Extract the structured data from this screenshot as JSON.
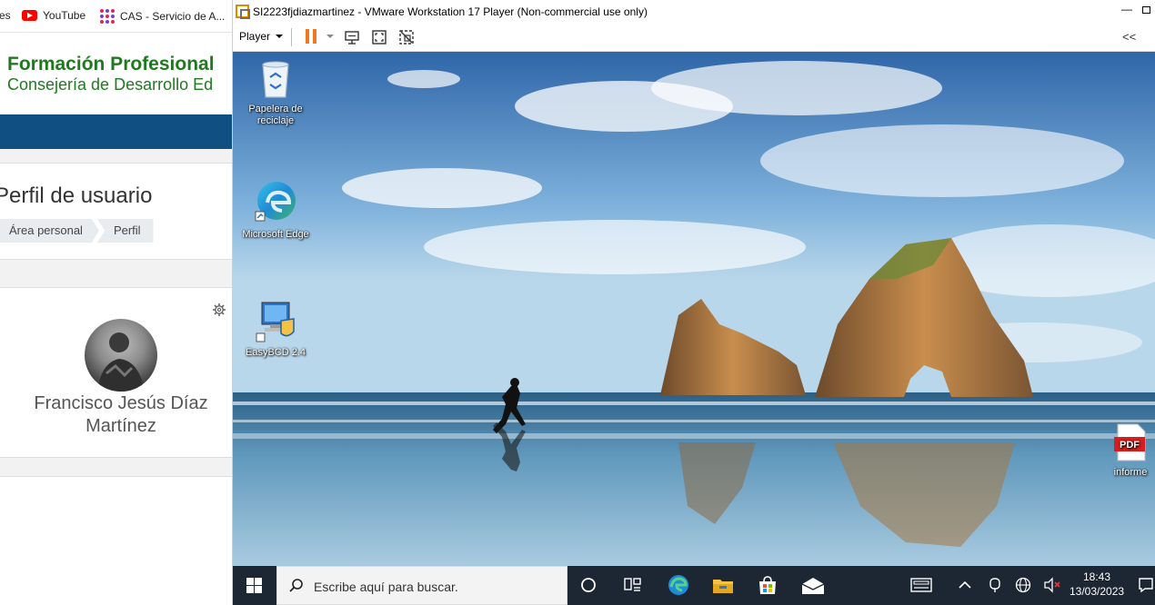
{
  "browser": {
    "bookmarks": [
      {
        "label": "es"
      },
      {
        "label": "YouTube",
        "icon": "youtube-icon"
      },
      {
        "label": "CAS - Servicio de A...",
        "icon": "cas-icon"
      }
    ],
    "header": {
      "title": "Formación Profesional",
      "subtitle": "Consejería de Desarrollo Ed"
    },
    "page_title": "Perfil de usuario",
    "breadcrumb": [
      "Área personal",
      "Perfil"
    ],
    "profile": {
      "name": "Francisco Jesús Díaz Martínez"
    },
    "colors": {
      "brand_green": "#1f7a1f",
      "navbar": "#0f4f82"
    }
  },
  "vmware": {
    "window_title": "SI2223fjdiazmartinez - VMware Workstation 17 Player (Non-commercial use only)",
    "menu_label": "Player",
    "collapse_label": "<<",
    "toolbar_icons": [
      "pause-icon",
      "send-ctrl-alt-del-icon",
      "fullscreen-icon",
      "unity-icon"
    ]
  },
  "desktop": {
    "icons": [
      {
        "label": "Papelera de reciclaje",
        "icon": "recycle-bin-icon"
      },
      {
        "label": "Microsoft Edge",
        "icon": "edge-icon"
      },
      {
        "label": "EasyBCD 2.4",
        "icon": "easybcd-icon"
      },
      {
        "label": "informe",
        "icon": "pdf-file-icon",
        "badge": "PDF"
      }
    ]
  },
  "taskbar": {
    "search_placeholder": "Escribe aquí para buscar.",
    "time": "18:43",
    "date": "13/03/2023",
    "pinned": [
      "cortana-icon",
      "task-view-icon",
      "edge-icon",
      "file-explorer-icon",
      "store-icon",
      "mail-icon"
    ],
    "tray": [
      "keyboard-icon",
      "chevron-up-icon",
      "meet-now-icon",
      "network-icon",
      "volume-muted-icon",
      "notifications-icon"
    ]
  }
}
